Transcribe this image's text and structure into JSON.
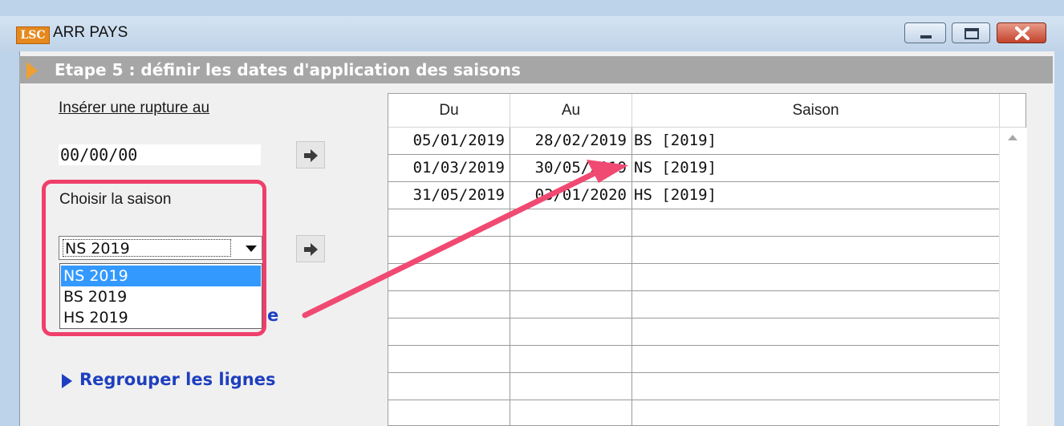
{
  "window": {
    "title": "ARR PAYS",
    "logo_text": "LSC",
    "controls": [
      "minimize-icon",
      "maximize-icon",
      "close-icon"
    ]
  },
  "step": {
    "title": "Etape 5 : définir les dates d'application des saisons"
  },
  "left_panel": {
    "insert_label": "Insérer une rupture au",
    "insert_value": "00/00/00",
    "choose_label": "Choisir la saison",
    "season_select": {
      "value": "NS 2019",
      "options": [
        "NS 2019",
        "BS 2019",
        "HS 2019"
      ],
      "highlighted_option": "NS 2019"
    },
    "obscured_link_tail": "e",
    "regroup_link": "Regrouper les lignes"
  },
  "grid": {
    "columns": [
      "Du",
      "Au",
      "Saison"
    ],
    "rows": [
      {
        "du": "05/01/2019",
        "au": "28/02/2019",
        "saison": "BS [2019]"
      },
      {
        "du": "01/03/2019",
        "au": "30/05/2019",
        "saison": "NS [2019]"
      },
      {
        "du": "31/05/2019",
        "au": "03/01/2020",
        "saison": "HS [2019]"
      }
    ]
  },
  "annotation": {
    "highlight_color": "#ef3f6a",
    "arrow_color": "#f04a72"
  },
  "colors": {
    "title_bar": "#bfd3e8",
    "step_bar": "#a6a6a6",
    "step_arrow": "#f0a030",
    "link": "#1e3fbf",
    "selection": "#3399ff"
  }
}
